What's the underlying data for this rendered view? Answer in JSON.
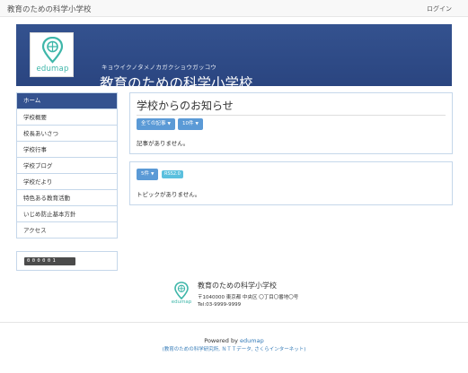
{
  "topbar": {
    "brand": "教育のための科学小学校",
    "login": "ログイン"
  },
  "banner": {
    "logo_text": "edumap",
    "kana": "キョウイクノタメノカガクショウガッコウ",
    "school_name": "教育のための科学小学校",
    "bg_color": "#2c4a86"
  },
  "sidebar": {
    "items": [
      {
        "label": "ホーム"
      },
      {
        "label": "学校概要"
      },
      {
        "label": "校長あいさつ"
      },
      {
        "label": "学校行事"
      },
      {
        "label": "学校ブログ"
      },
      {
        "label": "学校だより"
      },
      {
        "label": "特色ある教育活動"
      },
      {
        "label": "いじめ防止基本方針"
      },
      {
        "label": "アクセス"
      }
    ],
    "counter": "000001"
  },
  "news": {
    "title": "学校からのお知らせ",
    "filter_all": "全ての記事",
    "filter_count": "10件",
    "empty_message": "記事がありません。"
  },
  "topics": {
    "filter_count": "5件",
    "rss": "RSS2.0",
    "empty_message": "トピックがありません。"
  },
  "footer": {
    "logo_text": "edumap",
    "school_name": "教育のための科学小学校",
    "address": "〒1040000 東京都 中央区 〇丁目〇番地〇号",
    "tel": "Tel:03-9999-9999",
    "powered_prefix": "Powered by",
    "powered_link": "edumap",
    "sponsors": "(教育のための科学研究所, ＮＴＴデータ, さくらインターネット)"
  },
  "colors": {
    "accent": "#34528f",
    "button": "#5b9ad6",
    "tag": "#5bc0de",
    "logo": "#3eb6a9"
  }
}
